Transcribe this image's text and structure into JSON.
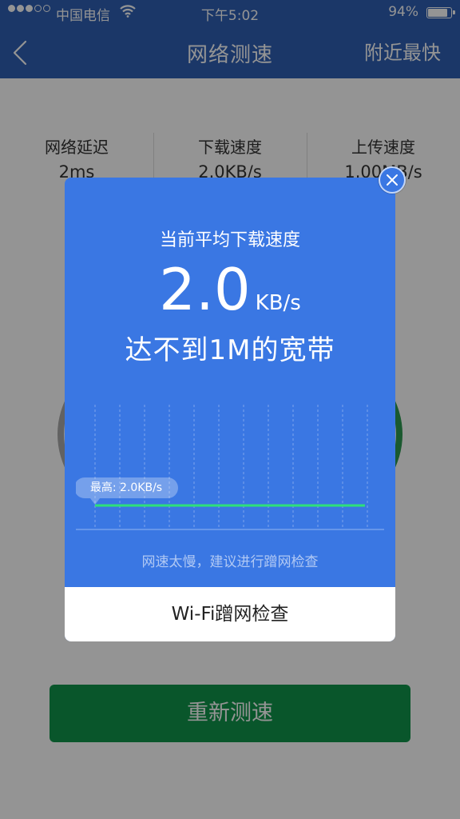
{
  "status_bar": {
    "carrier": "中国电信",
    "time": "下午5:02",
    "battery_percent": "94%",
    "battery_level": 0.94,
    "signal_strength": 3,
    "signal_max": 5
  },
  "nav": {
    "title": "网络测速",
    "right_label": "附近最快"
  },
  "stats": [
    {
      "label": "网络延迟",
      "value": "2ms"
    },
    {
      "label": "下载速度",
      "value": "2.0KB/s"
    },
    {
      "label": "上传速度",
      "value": "1.00MB/s"
    }
  ],
  "retest_label": "重新测速",
  "modal": {
    "subtitle": "当前平均下载速度",
    "speed_value": "2.0",
    "speed_unit": "KB/s",
    "message": "达不到1M的宽带",
    "chart_tooltip": "最高: 2.0KB/s",
    "hint": "网速太慢，建议进行蹭网检查",
    "footer_button": "Wi-Fi蹭网检查"
  },
  "colors": {
    "nav_blue": "#2f5fb3",
    "modal_blue": "#3a77e3",
    "line_green": "#2ee07a",
    "button_green": "#10954a"
  }
}
